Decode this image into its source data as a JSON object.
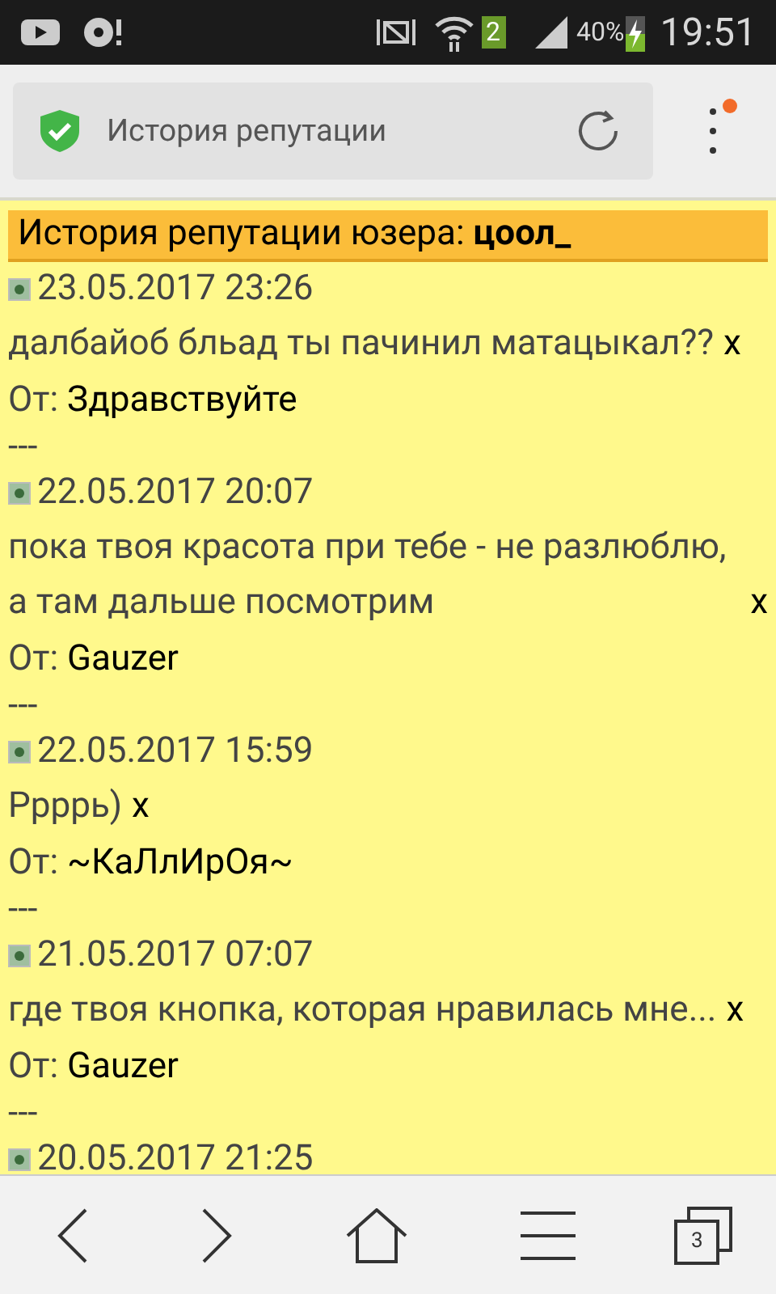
{
  "status_bar": {
    "battery": "40%",
    "time": "19:51",
    "sim": "2"
  },
  "address_bar": {
    "title": "История репутации"
  },
  "page": {
    "heading": "История репутации юзера: **цоол_**",
    "entries": [
      {
        "date": "23.05.2017 23:26",
        "message": "далбайоб бльад ты пачинил матацыкал??",
        "delete": "x",
        "from_label": "От:",
        "from": "Здравствуйте",
        "separator": "---"
      },
      {
        "date": "22.05.2017 20:07",
        "message": "пока твоя красота при тебе - не разлюблю, а там дальше посмотрим",
        "delete": "x",
        "from_label": "От:",
        "from": "Gauzer",
        "separator": "---"
      },
      {
        "date": "22.05.2017 15:59",
        "message": "Ррррь)",
        "delete": "x",
        "from_label": "От:",
        "from": "~КаЛлИрОя~",
        "separator": "---"
      },
      {
        "date": "21.05.2017 07:07",
        "message": "где твоя кнопка, которая нравилась мне...",
        "delete": "x",
        "from_label": "От:",
        "from": "Gauzer",
        "separator": "---"
      },
      {
        "date": "20.05.2017 21:25"
      }
    ]
  },
  "toolbar": {
    "tabs_count": "3"
  }
}
